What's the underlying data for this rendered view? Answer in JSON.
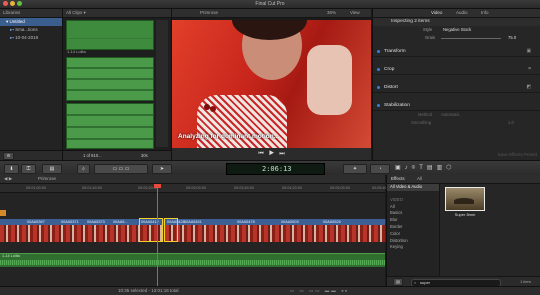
{
  "window": {
    "title": "Final Cut Pro",
    "traffic_colors": [
      "#ec5f57",
      "#e8b33d",
      "#5fc33f"
    ]
  },
  "libraries": {
    "header": "Libraries",
    "items": [
      {
        "label": "Untitled",
        "selected": true
      },
      {
        "label": "Sma...tions",
        "selected": false
      },
      {
        "label": "10-04-2018",
        "selected": false
      }
    ]
  },
  "browser": {
    "filter": "All Clips",
    "clip_label": "1-14 Lolita",
    "count": "1 of 810...",
    "duration": "30s"
  },
  "viewer": {
    "title": "Primrose",
    "zoom": "36%",
    "view": "View",
    "overlay": "Analyzing for dominant motion..."
  },
  "inspector": {
    "tabs": [
      "Video",
      "Audio",
      "Info"
    ],
    "summary": "Inspecting 2 items",
    "style_label": "Style",
    "style_value": "Negative Stock",
    "grain_label": "Grain",
    "grain_value": "75.0",
    "sections": [
      "Transform",
      "Crop",
      "Distort",
      "Stabilization"
    ],
    "method_label": "Method",
    "method_value": "Automatic",
    "smoothing_label": "Smoothing",
    "smoothing_value": "1.0",
    "save_preset": "Save Effects Preset"
  },
  "toolbar": {
    "timecode": "2:06:13"
  },
  "timeline": {
    "project": "Primrose",
    "ruler": [
      "00:01:00:00",
      "00:01:40:00",
      "00:02:20:00",
      "00:03:00:00",
      "00:03:40:00",
      "00:04:20:00",
      "00:05:00:00",
      "00:05:40:00"
    ],
    "clips": [
      "00AA5367",
      "00AA5371",
      "00AA5373",
      "00AA5...",
      "00AA5412",
      "00AA5428",
      "00AA5451",
      "00AA5478",
      "00AA5503",
      "00AA5526"
    ],
    "audio_label": "1-14 Lolita",
    "status": "10:35 selected - 13:01:16 total"
  },
  "effects": {
    "title": "Effects",
    "scope": "All",
    "categories": [
      "All Video & Audio",
      "VIDEO",
      "All",
      "Basics",
      "Blur",
      "Border",
      "Color",
      "Distortion",
      "Keying"
    ],
    "selected_category": "All Video & Audio",
    "result_name": "Super 8mm",
    "search_value": "super",
    "count": "1 item"
  }
}
